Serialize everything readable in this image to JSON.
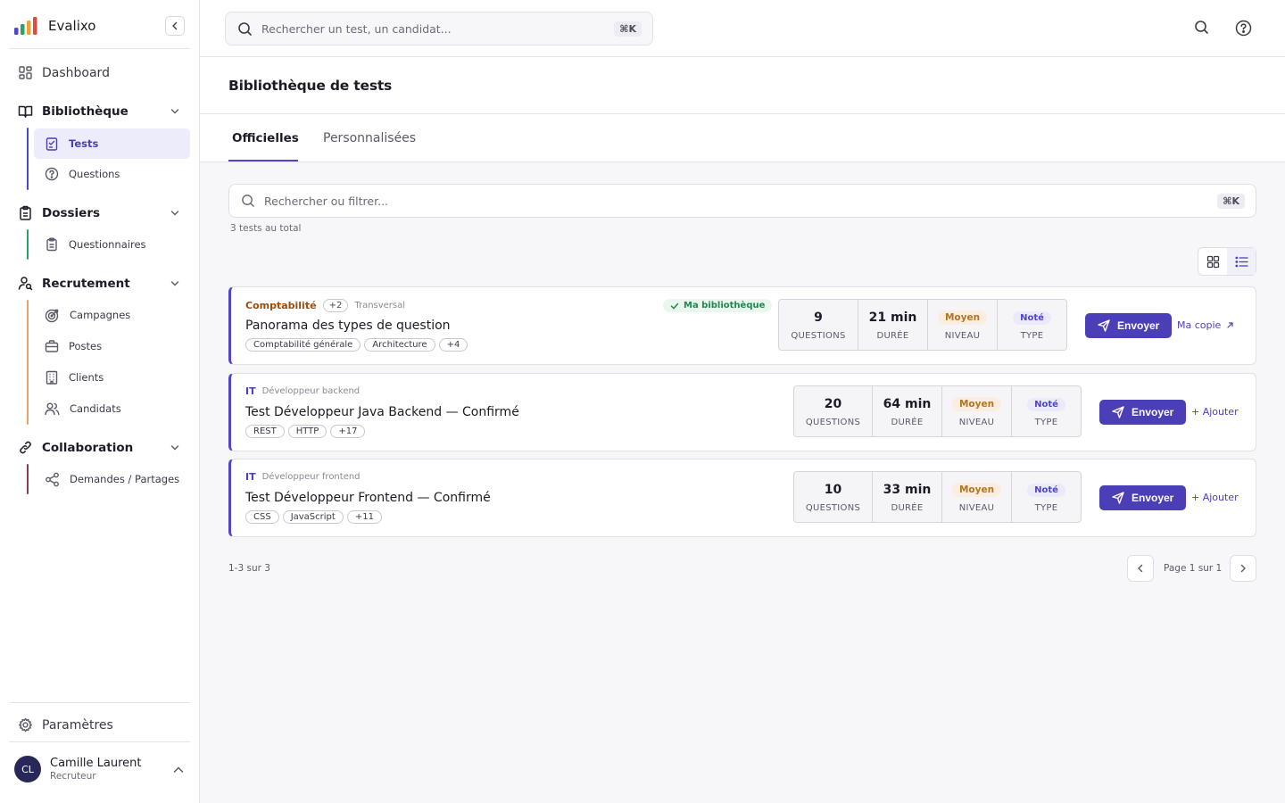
{
  "brand": {
    "name": "Evalixo"
  },
  "sidebar": {
    "dashboard": "Dashboard",
    "bibliotheque": {
      "label": "Bibliothèque",
      "items": [
        "Tests",
        "Questions"
      ]
    },
    "dossiers": {
      "label": "Dossiers",
      "items": [
        "Questionnaires"
      ]
    },
    "recrutement": {
      "label": "Recrutement",
      "items": [
        "Campagnes",
        "Postes",
        "Clients",
        "Candidats"
      ]
    },
    "collaboration": {
      "label": "Collaboration",
      "items": [
        "Demandes / Partages"
      ]
    },
    "settings": "Paramètres",
    "user": {
      "initials": "CL",
      "name": "Camille Laurent",
      "role": "Recruteur"
    }
  },
  "topbar": {
    "search_placeholder": "Rechercher un test, un candidat...",
    "shortcut": "⌘K"
  },
  "page": {
    "title": "Bibliothèque de tests"
  },
  "tabs": [
    "Officielles",
    "Personnalisées"
  ],
  "library": {
    "search_placeholder": "Rechercher ou filtrer...",
    "shortcut": "⌘K",
    "total": "3 tests au total",
    "stat_labels": {
      "questions": "QUESTIONS",
      "duree": "DURÉE",
      "niveau": "NIVEAU",
      "type": "TYPE"
    },
    "send_label": "Envoyer",
    "cards": [
      {
        "category": "Comptabilité",
        "category_color": "#9a4d10",
        "category_count": "+2",
        "subcategory": "Transversal",
        "badge": "Ma bibliothèque",
        "title": "Panorama des types de question",
        "chips": [
          "Comptabilité générale",
          "Architecture",
          "+4"
        ],
        "questions": "9",
        "duree": "21 min",
        "niveau": "Moyen",
        "type": "Noté",
        "action": "Ma copie"
      },
      {
        "category": "IT",
        "category_color": "#4b3fb8",
        "subcategory": "Développeur backend",
        "title": "Test Développeur Java Backend — Confirmé",
        "chips": [
          "REST",
          "HTTP",
          "+17"
        ],
        "questions": "20",
        "duree": "64 min",
        "niveau": "Moyen",
        "type": "Noté",
        "action": "+ Ajouter"
      },
      {
        "category": "IT",
        "category_color": "#4b3fb8",
        "subcategory": "Développeur frontend",
        "title": "Test Développeur Frontend — Confirmé",
        "chips": [
          "CSS",
          "JavaScript",
          "+11"
        ],
        "questions": "10",
        "duree": "33 min",
        "niveau": "Moyen",
        "type": "Noté",
        "action": "+ Ajouter"
      }
    ]
  },
  "pagination": {
    "range": "1-3 sur 3",
    "page_label": "Page 1 sur 1"
  }
}
